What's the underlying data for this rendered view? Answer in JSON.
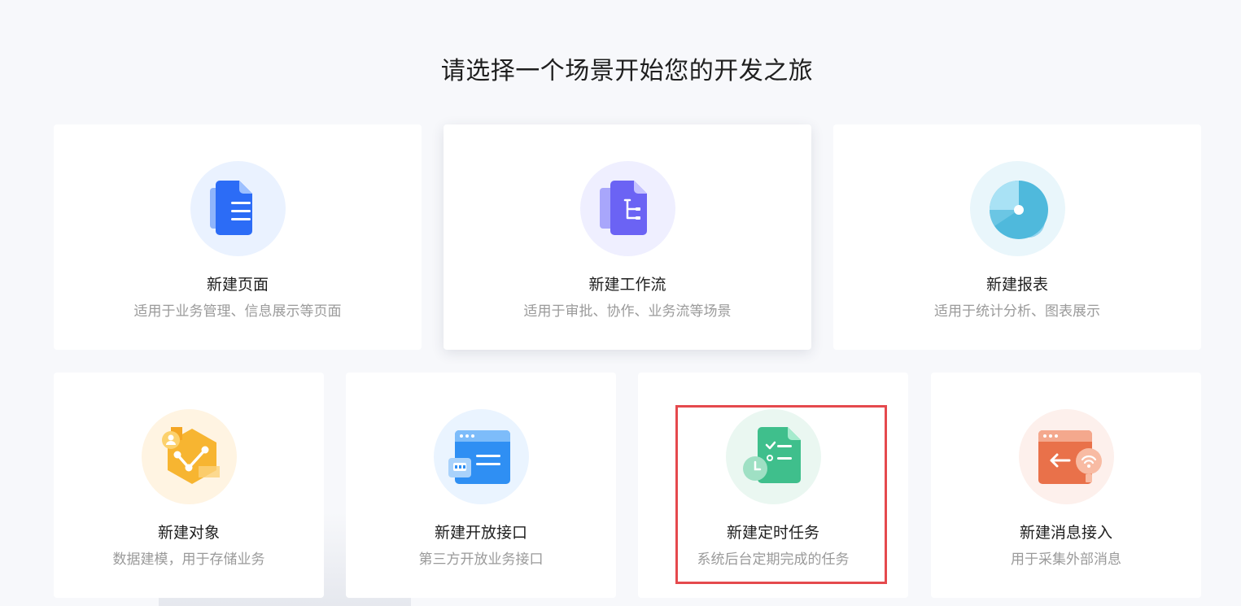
{
  "heading": "请选择一个场景开始您的开发之旅",
  "cards": [
    {
      "title": "新建页面",
      "desc": "适用于业务管理、信息展示等页面",
      "icon": "document-icon"
    },
    {
      "title": "新建工作流",
      "desc": "适用于审批、协作、业务流等场景",
      "icon": "workflow-icon"
    },
    {
      "title": "新建报表",
      "desc": "适用于统计分析、图表展示",
      "icon": "pie-chart-icon"
    },
    {
      "title": "新建对象",
      "desc": "数据建模，用于存储业务",
      "icon": "data-object-icon"
    },
    {
      "title": "新建开放接口",
      "desc": "第三方开放业务接口",
      "icon": "api-interface-icon"
    },
    {
      "title": "新建定时任务",
      "desc": "系统后台定期完成的任务",
      "icon": "scheduled-task-icon"
    },
    {
      "title": "新建消息接入",
      "desc": "用于采集外部消息",
      "icon": "message-inbound-icon"
    }
  ],
  "colors": {
    "background": "#f7f8fb",
    "highlight_border": "#e5494d",
    "page_blue": "#2c6cf6",
    "workflow_purple": "#6b63f4",
    "report_cyan": "#4fb9dc",
    "object_orange": "#f7b531",
    "api_blue": "#2f8ff3",
    "task_green": "#3fbf8c",
    "message_orange": "#e9714a"
  }
}
